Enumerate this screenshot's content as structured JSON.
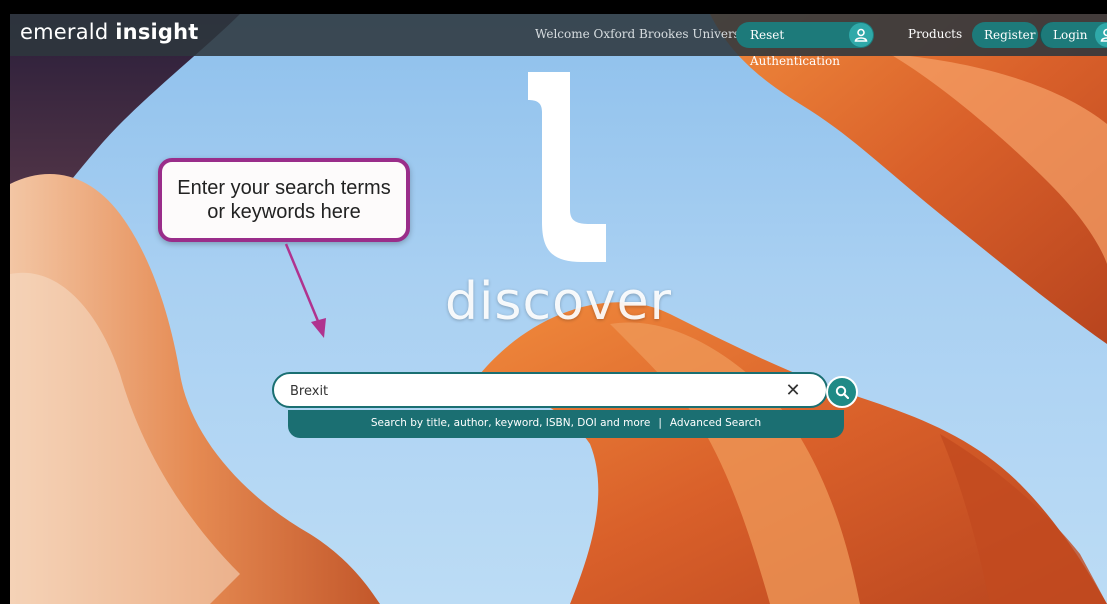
{
  "header": {
    "logo_light": "emerald",
    "logo_bold": "insight",
    "welcome": "Welcome Oxford Brookes University",
    "reset_label": "Reset Authentication",
    "products_label": "Products",
    "register_label": "Register",
    "login_label": "Login"
  },
  "hero": {
    "tagline": "discover"
  },
  "callout": {
    "line1": "Enter your search terms",
    "line2": "or keywords here"
  },
  "search": {
    "value": "Brexit",
    "clear_glyph": "✕",
    "hint": "Search by title, author, keyword, ISBN, DOI and more",
    "separator": "|",
    "advanced_label": "Advanced Search"
  },
  "colors": {
    "accent": "#1d7a7a",
    "callout_border": "#9a2d8a",
    "header_bg": "#2d373e"
  }
}
